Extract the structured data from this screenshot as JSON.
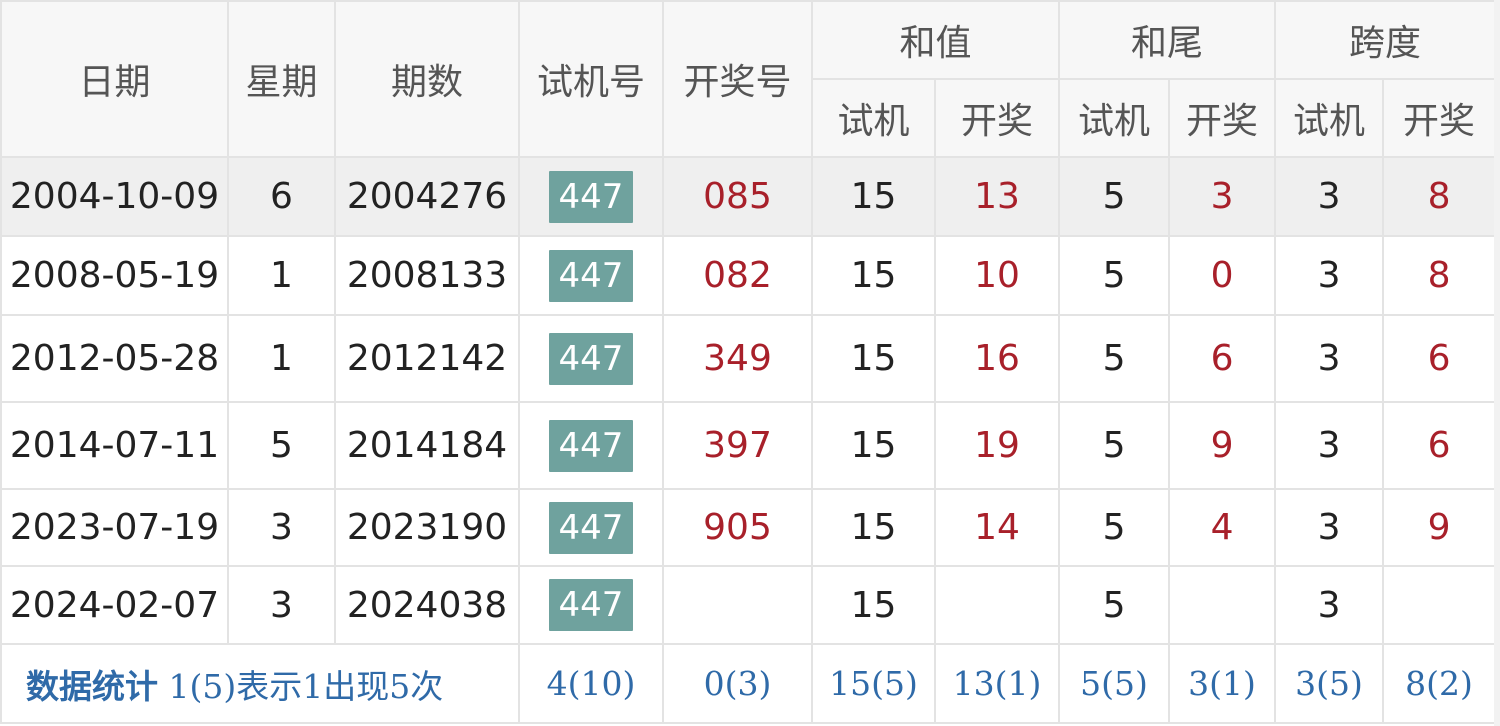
{
  "columns": {
    "date": "日期",
    "weekday": "星期",
    "issue": "期数",
    "trial_number": "试机号",
    "draw_number": "开奖号"
  },
  "groups": {
    "sum": "和值",
    "sum_tail": "和尾",
    "span": "跨度"
  },
  "subcolumns": {
    "trial": "试机",
    "draw": "开奖"
  },
  "rows": [
    {
      "date": "2004-10-09",
      "weekday": "6",
      "issue": "2004276",
      "trial": "447",
      "draw": "085",
      "sum_trial": "15",
      "sum_draw": "13",
      "tail_trial": "5",
      "tail_draw": "3",
      "span_trial": "3",
      "span_draw": "8",
      "highlight": true
    },
    {
      "date": "2008-05-19",
      "weekday": "1",
      "issue": "2008133",
      "trial": "447",
      "draw": "082",
      "sum_trial": "15",
      "sum_draw": "10",
      "tail_trial": "5",
      "tail_draw": "0",
      "span_trial": "3",
      "span_draw": "8",
      "highlight": false
    },
    {
      "date": "2012-05-28",
      "weekday": "1",
      "issue": "2012142",
      "trial": "447",
      "draw": "349",
      "sum_trial": "15",
      "sum_draw": "16",
      "tail_trial": "5",
      "tail_draw": "6",
      "span_trial": "3",
      "span_draw": "6",
      "highlight": false
    },
    {
      "date": "2014-07-11",
      "weekday": "5",
      "issue": "2014184",
      "trial": "447",
      "draw": "397",
      "sum_trial": "15",
      "sum_draw": "19",
      "tail_trial": "5",
      "tail_draw": "9",
      "span_trial": "3",
      "span_draw": "6",
      "highlight": false
    },
    {
      "date": "2023-07-19",
      "weekday": "3",
      "issue": "2023190",
      "trial": "447",
      "draw": "905",
      "sum_trial": "15",
      "sum_draw": "14",
      "tail_trial": "5",
      "tail_draw": "4",
      "span_trial": "3",
      "span_draw": "9",
      "highlight": false
    },
    {
      "date": "2024-02-07",
      "weekday": "3",
      "issue": "2024038",
      "trial": "447",
      "draw": "",
      "sum_trial": "15",
      "sum_draw": "",
      "tail_trial": "5",
      "tail_draw": "",
      "span_trial": "3",
      "span_draw": "",
      "highlight": false
    }
  ],
  "stats": {
    "label": "数据统计",
    "note": "1(5)表示1出现5次",
    "trial": "4(10)",
    "draw": "0(3)",
    "sum_trial": "15(5)",
    "sum_draw": "13(1)",
    "tail_trial": "5(5)",
    "tail_draw": "3(1)",
    "span_trial": "3(5)",
    "span_draw": "8(2)"
  },
  "colors": {
    "trial_badge_bg": "#6fa29e",
    "draw_red": "#a8202a",
    "stats_blue": "#2f6aa8",
    "header_bg": "#f7f7f7",
    "highlight_row_bg": "#efefef",
    "border": "#e3e3e3"
  }
}
